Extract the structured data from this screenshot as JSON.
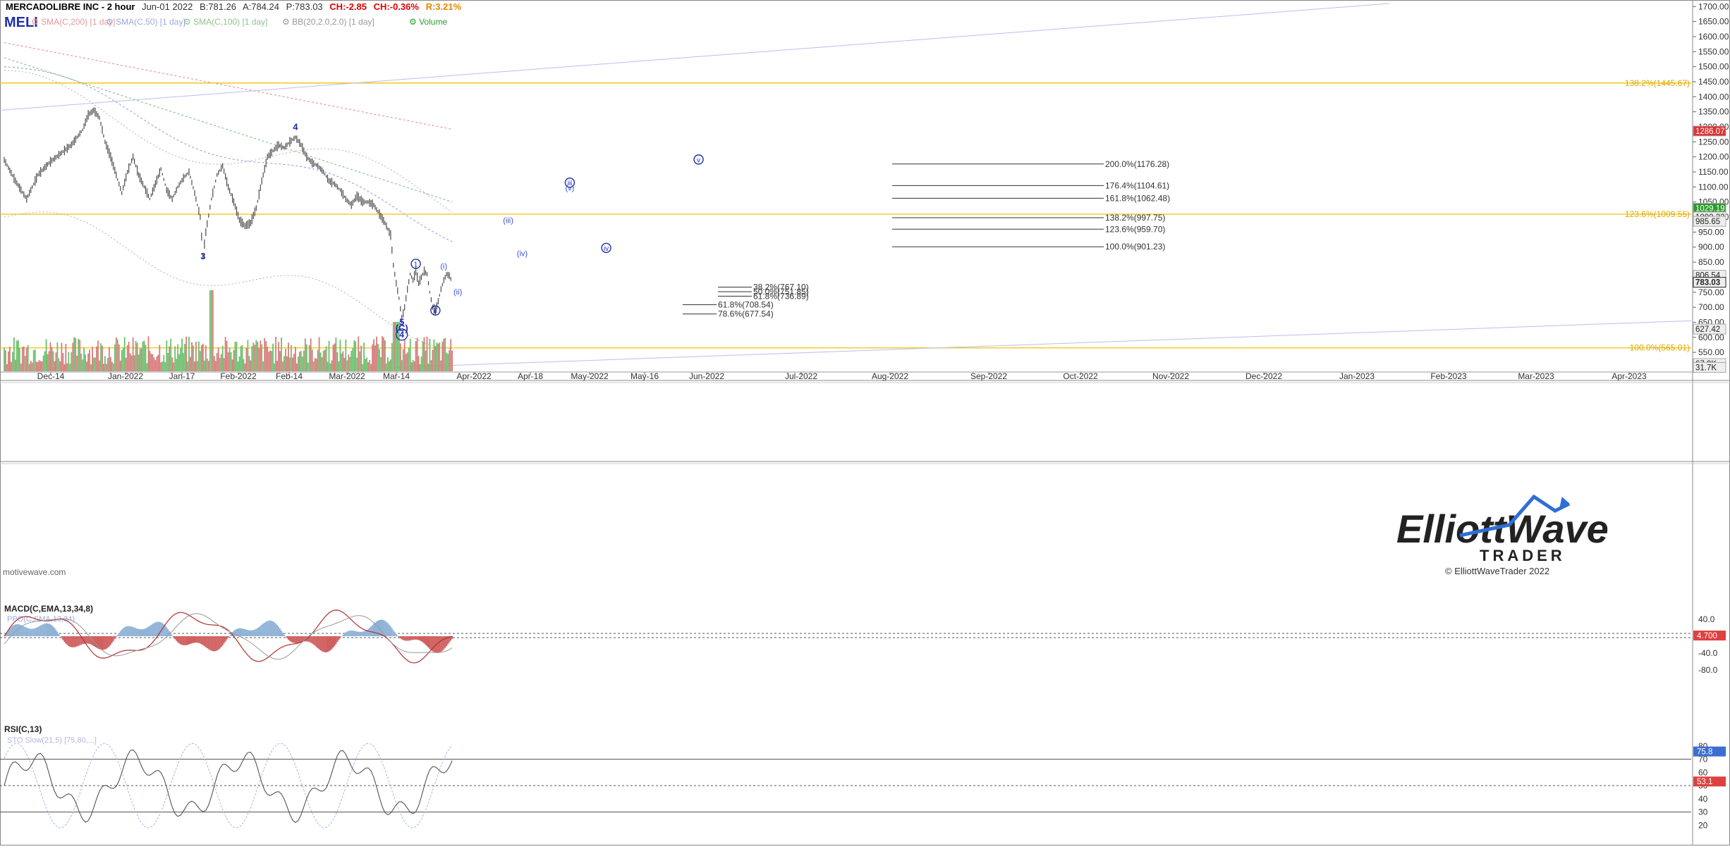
{
  "header": {
    "symbol_full": "MERCADOLIBRE INC - 2 hour",
    "date": "Jun-01 2022",
    "bid": "B:781.26",
    "ask": "A:784.24",
    "price": "P:783.03",
    "ch_abs": "CH:-2.85",
    "ch_pct": "CH:-0.36%",
    "range_pct": "R:3.21%",
    "ticker": "MELI",
    "indicators": [
      "SMA(C,200) [1 day]",
      "SMA(C,50) [1 day]",
      "SMA(C,100) [1 day]",
      "BB(20,2.0,2.0) [1 day]",
      "Volume"
    ]
  },
  "watermark": "motivewave.com",
  "logo": {
    "line1": "ElliottWave",
    "line2": "TRADER",
    "copyright": "© ElliottWaveTrader 2022"
  },
  "colors": {
    "price": "#4a4a4a",
    "fib_orange": "#f2c200",
    "wave_label": "#1f2fa8",
    "projection": "#3a4fd0",
    "up_vol": "#6cbf6c",
    "down_vol": "#d77b7b",
    "macd_hist_pos": "#8fb3d6",
    "macd_hist_neg": "#d06060",
    "bg": "#ffffff"
  },
  "chart_data": [
    {
      "type": "line",
      "name": "price",
      "x_axis_labels": [
        "Dec-14",
        "Jan-2022",
        "Jan-17",
        "Feb-2022",
        "Feb-14",
        "Mar-2022",
        "Mar-14",
        "Apr-2022",
        "Apr-18",
        "May-2022",
        "May-16",
        "Jun-2022",
        "Jul-2022",
        "Aug-2022",
        "Sep-2022",
        "Oct-2022",
        "Nov-2022",
        "Dec-2022",
        "Jan-2023",
        "Feb-2023",
        "Mar-2023",
        "Apr-2023"
      ],
      "y_ticks": [
        "1700.00",
        "1650.00",
        "1600.00",
        "1550.00",
        "1500.00",
        "1450.00",
        "1400.00",
        "1350.00",
        "1300.00",
        "1250.00",
        "1200.00",
        "1150.00",
        "1100.00",
        "1050.00",
        "1000.00",
        "950.00",
        "900.00",
        "850.00",
        "800.00",
        "750.00",
        "700.00",
        "650.00",
        "600.00",
        "550.00",
        "500.00"
      ],
      "ylim": [
        480,
        1710
      ],
      "y_markers": [
        {
          "label": "1286.07",
          "value": 1286.07,
          "style": "red"
        },
        {
          "label": "1029.19",
          "value": 1029.19,
          "style": "green"
        },
        {
          "label": "1000.32",
          "value": 1000.32,
          "style": "grey"
        },
        {
          "label": "985.65",
          "value": 985.65,
          "style": "grey"
        },
        {
          "label": "806.54",
          "value": 806.54,
          "style": "grey"
        },
        {
          "label": "783.03",
          "value": 783.03,
          "style": "dark"
        },
        {
          "label": "627.42",
          "value": 627.42,
          "style": "grey"
        },
        {
          "label": "67.9K",
          "value": 513,
          "style": "grey"
        },
        {
          "label": "31.7K",
          "value": 500,
          "style": "grey"
        }
      ],
      "series_points": [
        [
          0,
          1190
        ],
        [
          4,
          1120
        ],
        [
          8,
          1060
        ],
        [
          12,
          1140
        ],
        [
          16,
          1180
        ],
        [
          20,
          1210
        ],
        [
          24,
          1240
        ],
        [
          28,
          1290
        ],
        [
          30,
          1340
        ],
        [
          32,
          1355
        ],
        [
          34,
          1330
        ],
        [
          36,
          1250
        ],
        [
          38,
          1200
        ],
        [
          40,
          1140
        ],
        [
          42,
          1080
        ],
        [
          44,
          1150
        ],
        [
          46,
          1200
        ],
        [
          48,
          1140
        ],
        [
          50,
          1100
        ],
        [
          52,
          1060
        ],
        [
          54,
          1110
        ],
        [
          56,
          1160
        ],
        [
          58,
          1090
        ],
        [
          60,
          1060
        ],
        [
          62,
          1100
        ],
        [
          64,
          1130
        ],
        [
          66,
          1150
        ],
        [
          68,
          1080
        ],
        [
          70,
          1000
        ],
        [
          71,
          870
        ],
        [
          72,
          950
        ],
        [
          74,
          1060
        ],
        [
          76,
          1140
        ],
        [
          78,
          1170
        ],
        [
          80,
          1100
        ],
        [
          82,
          1050
        ],
        [
          84,
          990
        ],
        [
          86,
          970
        ],
        [
          88,
          980
        ],
        [
          90,
          1030
        ],
        [
          92,
          1120
        ],
        [
          94,
          1200
        ],
        [
          96,
          1220
        ],
        [
          98,
          1240
        ],
        [
          100,
          1230
        ],
        [
          102,
          1250
        ],
        [
          104,
          1265
        ],
        [
          106,
          1240
        ],
        [
          108,
          1200
        ],
        [
          110,
          1180
        ],
        [
          112,
          1170
        ],
        [
          114,
          1150
        ],
        [
          116,
          1120
        ],
        [
          118,
          1110
        ],
        [
          120,
          1090
        ],
        [
          122,
          1060
        ],
        [
          124,
          1040
        ],
        [
          126,
          1070
        ],
        [
          128,
          1050
        ],
        [
          130,
          1050
        ],
        [
          132,
          1040
        ],
        [
          134,
          1010
        ],
        [
          136,
          980
        ],
        [
          138,
          940
        ],
        [
          139,
          840
        ],
        [
          140,
          780
        ],
        [
          141,
          730
        ],
        [
          142,
          660
        ],
        [
          143,
          700
        ],
        [
          144,
          760
        ],
        [
          145,
          810
        ],
        [
          146,
          790
        ],
        [
          147,
          820
        ],
        [
          148,
          780
        ],
        [
          149,
          800
        ],
        [
          150,
          820
        ],
        [
          151,
          810
        ],
        [
          152,
          750
        ],
        [
          153,
          700
        ],
        [
          154,
          690
        ],
        [
          155,
          720
        ],
        [
          156,
          760
        ],
        [
          157,
          790
        ],
        [
          158,
          810
        ],
        [
          159,
          805
        ],
        [
          160,
          783
        ]
      ]
    },
    {
      "type": "bar",
      "name": "volume",
      "x_index": [
        0,
        160
      ],
      "peak_note": "spike near Feb-14"
    },
    {
      "type": "line",
      "name": "MACD(C,EMA,13,34,8)",
      "sublabel": "PPO(C,SMA,13,34)",
      "y_ticks": [
        "40.0",
        "0.0",
        "-40.0",
        "-80.0"
      ],
      "value_tag": "4.700",
      "ylim": [
        -100,
        70
      ]
    },
    {
      "type": "line",
      "name": "RSI(C,13)",
      "sublabel": "STO Slow(21,5) [75,80,...]",
      "y_ticks": [
        "80",
        "70",
        "60",
        "50",
        "40",
        "30",
        "20"
      ],
      "value_tags": [
        "75.8",
        "53.1"
      ],
      "ylim": [
        10,
        90
      ]
    }
  ],
  "fib_lines_orange": [
    {
      "label": "138.2%(1445.67)",
      "value": 1445.67
    },
    {
      "label": "123.6%(1009.55)",
      "value": 1009.55
    },
    {
      "label": "100.0%(565.01)",
      "value": 565.01
    }
  ],
  "fib_targets": [
    {
      "label": "200.0%(1176.28)",
      "value": 1176.28
    },
    {
      "label": "176.4%(1104.61)",
      "value": 1104.61
    },
    {
      "label": "161.8%(1062.48)",
      "value": 1062.48
    },
    {
      "label": "138.2%(997.75)",
      "value": 997.75
    },
    {
      "label": "123.6%(959.70)",
      "value": 959.7
    },
    {
      "label": "100.0%(901.23)",
      "value": 901.23
    }
  ],
  "fib_retrace": [
    {
      "label": "38.2%(767.10)",
      "value": 767.1
    },
    {
      "label": "50.0%(751.85)",
      "value": 751.85
    },
    {
      "label": "61.8%(736.89)",
      "value": 736.89
    },
    {
      "label": "61.8%(708.54)",
      "value": 708.54
    },
    {
      "label": "78.6%(677.54)",
      "value": 677.54
    }
  ],
  "wave_labels": [
    {
      "text": "3",
      "value": 860,
      "idx": 71,
      "boxed": false
    },
    {
      "text": "4",
      "value": 1290,
      "idx": 104,
      "boxed": false
    },
    {
      "text": "5",
      "value": 640,
      "idx": 142,
      "boxed": false
    },
    {
      "text": "(C)",
      "value": 620,
      "idx": 142,
      "boxed": false
    },
    {
      "text": "4",
      "value": 600,
      "idx": 142,
      "boxed": true,
      "circle": true
    },
    {
      "text": "1",
      "value": 835,
      "idx": 147,
      "circle": true
    },
    {
      "text": "i",
      "value": 828,
      "idx": 157,
      "paren": true
    },
    {
      "text": "ii",
      "value": 742,
      "idx": 162,
      "paren": true
    },
    {
      "text": "ii",
      "value": 680,
      "idx": 154,
      "circle": true
    },
    {
      "text": "iii",
      "value": 980,
      "idx": 180,
      "paren": true
    },
    {
      "text": "iv",
      "value": 870,
      "idx": 185,
      "paren": true
    },
    {
      "text": "iii",
      "value": 1105,
      "idx": 202,
      "circle": true
    },
    {
      "text": "v",
      "value": 1088,
      "idx": 202,
      "paren": true
    },
    {
      "text": "iv",
      "value": 888,
      "idx": 215,
      "circle": true
    },
    {
      "text": "v",
      "value": 1182,
      "idx": 248,
      "circle": true
    }
  ]
}
